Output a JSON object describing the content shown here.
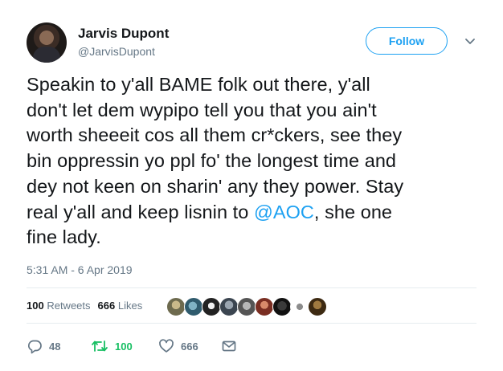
{
  "tweet": {
    "author": {
      "display_name": "Jarvis Dupont",
      "handle": "@JarvisDupont",
      "avatar_icon": "profile-photo"
    },
    "follow_label": "Follow",
    "text_lines": [
      "Speakin to y'all BAME folk out there, y'all",
      "don't let dem wypipo tell you that you ain't",
      "worth sheeeit cos all them cr*ckers, see they",
      "bin oppressin yo ppl fo' the longest time and",
      "dey not keen on sharin' any they power. Stay"
    ],
    "text_last_pre": "real y'all and keep lisnin to ",
    "mention": "@AOC",
    "text_last_post": ", she one",
    "text_final_line": "fine lady.",
    "timestamp": "5:31 AM - 6 Apr 2019",
    "stats": {
      "retweets_count": "100",
      "retweets_label": "Retweets",
      "likes_count": "666",
      "likes_label": "Likes"
    },
    "liker_avatar_count": 9,
    "actions": {
      "replies": "48",
      "retweets": "100",
      "likes": "666"
    }
  },
  "colors": {
    "accent": "#1da1f2",
    "text": "#14171a",
    "secondary": "#657786",
    "retweet_green": "#17bf63",
    "divider": "#e6ecf0"
  },
  "icons": {
    "caret": "chevron-down-icon",
    "reply": "reply-icon",
    "retweet": "retweet-icon",
    "like": "heart-icon",
    "message": "envelope-icon"
  }
}
